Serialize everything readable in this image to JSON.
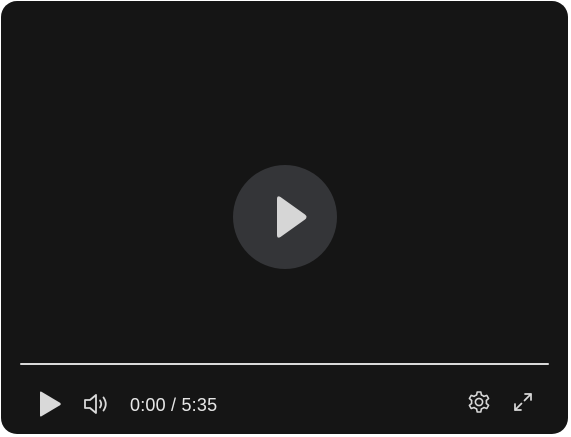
{
  "player": {
    "center_play_icon": "play-icon",
    "progress": 0.0,
    "controls": {
      "play_icon": "play-icon",
      "volume_icon": "volume-icon",
      "current_time": "0:00",
      "separator": " / ",
      "duration": "5:35",
      "settings_icon": "gear-icon",
      "fullscreen_icon": "expand-icon"
    }
  },
  "colors": {
    "background": "#151515",
    "center_button": "#343538",
    "icon": "#d9d9d9",
    "progress_track": "#d9d9d9"
  }
}
